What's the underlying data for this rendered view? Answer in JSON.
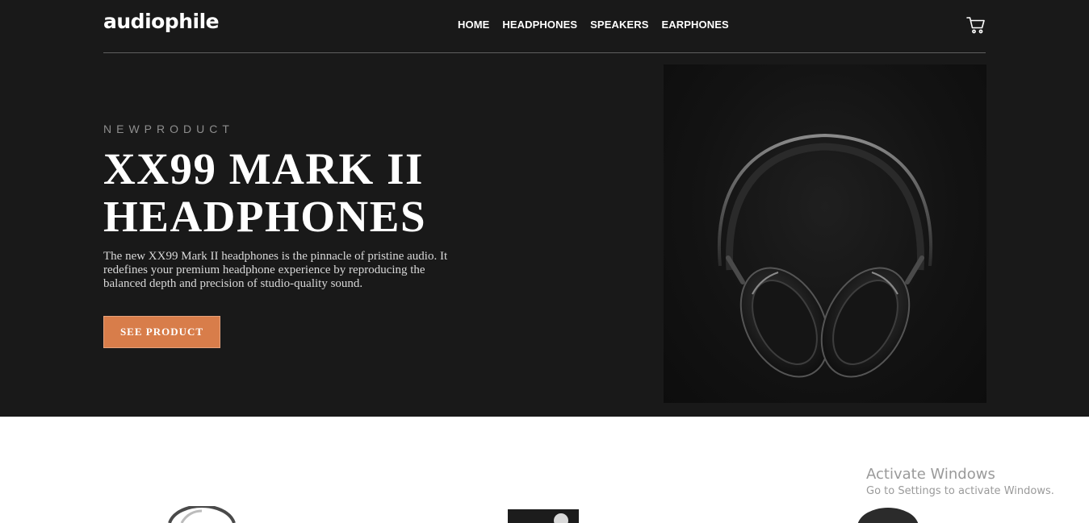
{
  "header": {
    "logo": "audiophile",
    "nav": [
      "HOME",
      "HEADPHONES",
      "SPEAKERS",
      "EARPHONES"
    ]
  },
  "hero": {
    "eyebrow": "NEWPRODUCT",
    "title": "XX99 MARK II HEADPHONES",
    "description": "The new XX99 Mark II headphones is the pinnacle of pristine audio. It redefines your premium headphone experience by reproducing the balanced depth and precision of studio-quality sound.",
    "cta": "SEE PRODUCT"
  },
  "watermark": {
    "line1": "Activate Windows",
    "line2": "Go to Settings to activate Windows."
  },
  "icons": {
    "cart": "cart-icon"
  },
  "colors": {
    "hero_background": "#191919",
    "accent": "#d87d4a",
    "text_light": "#ffffff"
  }
}
